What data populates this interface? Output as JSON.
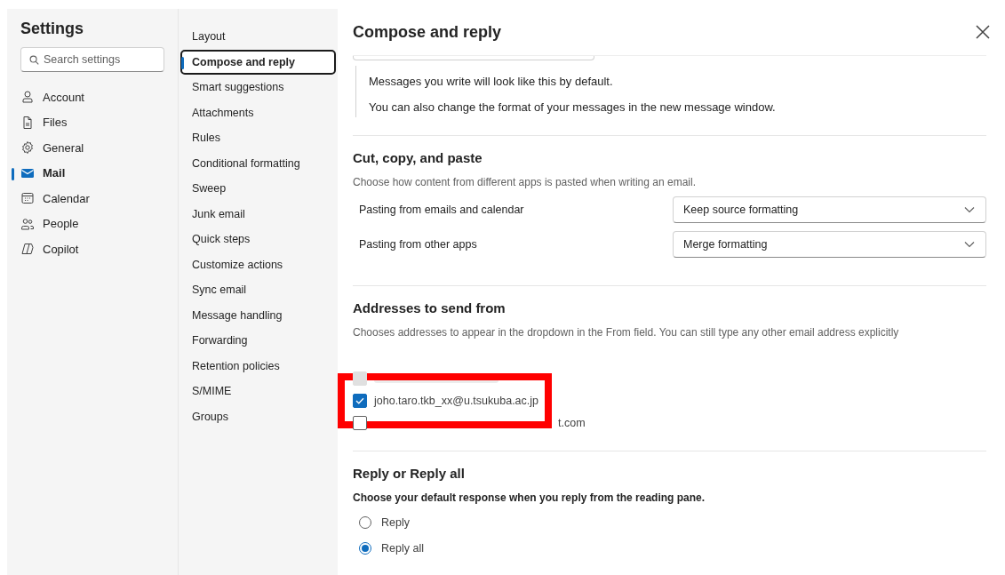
{
  "sidebar": {
    "title": "Settings",
    "search": {
      "placeholder": "Search settings"
    },
    "items": [
      {
        "label": "Account",
        "selected": false
      },
      {
        "label": "Files",
        "selected": false
      },
      {
        "label": "General",
        "selected": false
      },
      {
        "label": "Mail",
        "selected": true
      },
      {
        "label": "Calendar",
        "selected": false
      },
      {
        "label": "People",
        "selected": false
      },
      {
        "label": "Copilot",
        "selected": false
      }
    ]
  },
  "subnav": {
    "items": [
      {
        "label": "Layout",
        "selected": false
      },
      {
        "label": "Compose and reply",
        "selected": true
      },
      {
        "label": "Smart suggestions",
        "selected": false
      },
      {
        "label": "Attachments",
        "selected": false
      },
      {
        "label": "Rules",
        "selected": false
      },
      {
        "label": "Conditional formatting",
        "selected": false
      },
      {
        "label": "Sweep",
        "selected": false
      },
      {
        "label": "Junk email",
        "selected": false
      },
      {
        "label": "Quick steps",
        "selected": false
      },
      {
        "label": "Customize actions",
        "selected": false
      },
      {
        "label": "Sync email",
        "selected": false
      },
      {
        "label": "Message handling",
        "selected": false
      },
      {
        "label": "Forwarding",
        "selected": false
      },
      {
        "label": "Retention policies",
        "selected": false
      },
      {
        "label": "S/MIME",
        "selected": false
      },
      {
        "label": "Groups",
        "selected": false
      }
    ]
  },
  "panel": {
    "title": "Compose and reply",
    "preview_lines": [
      "Messages you write will look like this by default.",
      "You can also change the format of your messages in the new message window."
    ],
    "paste": {
      "heading": "Cut, copy, and paste",
      "description": "Choose how content from different apps is pasted when writing an email.",
      "rows": [
        {
          "label": "Pasting from emails and calendar",
          "value": "Keep source formatting"
        },
        {
          "label": "Pasting from other apps",
          "value": "Merge formatting"
        }
      ]
    },
    "addresses": {
      "heading": "Addresses to send from",
      "description": "Chooses addresses to appear in the dropdown in the From field. You can still type any other email address explicitly",
      "items": [
        {
          "kind": "blurred",
          "checked": false,
          "disabled": true
        },
        {
          "kind": "plain",
          "label": "joho.taro.tkb_xx@u.tsukuba.ac.jp",
          "checked": true,
          "disabled": false
        },
        {
          "kind": "covered",
          "label": "t.com",
          "checked": false,
          "disabled": false
        }
      ]
    },
    "reply": {
      "heading": "Reply or Reply all",
      "description": "Choose your default response when you reply from the reading pane.",
      "options": [
        {
          "label": "Reply",
          "selected": false
        },
        {
          "label": "Reply all",
          "selected": true
        }
      ]
    }
  }
}
